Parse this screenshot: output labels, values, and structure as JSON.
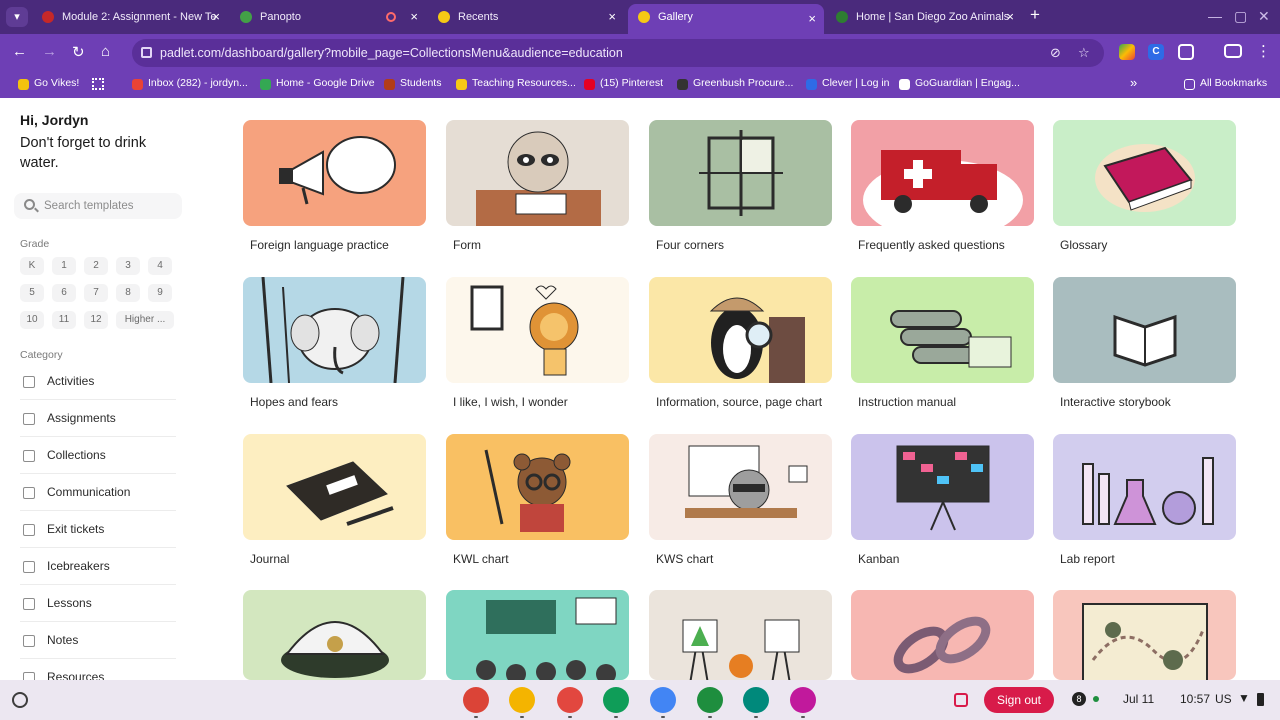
{
  "browser": {
    "tabs": [
      {
        "title": "Module 2: Assignment - New Te",
        "color": "#c62828"
      },
      {
        "title": "Panopto",
        "color": "#43a047"
      },
      {
        "title": "Recents",
        "color": "#f6c915"
      },
      {
        "title": "Gallery",
        "color": "#f6c915"
      },
      {
        "title": "Home | San Diego Zoo Animals",
        "color": "#2e7d32"
      }
    ],
    "url": "padlet.com/dashboard/gallery?mobile_page=CollectionsMenu&audience=education",
    "bookmarks": [
      {
        "label": "Go Vikes!",
        "color": "#f4c20d"
      },
      {
        "label": "Inbox (282) - jordyn...",
        "color": "#ea4335"
      },
      {
        "label": "Home - Google Drive",
        "color": "#34a853"
      },
      {
        "label": "Students",
        "color": "#b23c17"
      },
      {
        "label": "Teaching Resources...",
        "color": "#f6c915"
      },
      {
        "label": "(15) Pinterest",
        "color": "#e60023"
      },
      {
        "label": "Greenbush Procure...",
        "color": "#333333"
      },
      {
        "label": "Clever | Log in",
        "color": "#2e6be6"
      },
      {
        "label": "GoGuardian | Engag...",
        "color": "#ffffff"
      }
    ],
    "all_bookmarks": "All Bookmarks",
    "more_bookmarks": "»"
  },
  "sidebar": {
    "greeting": "Hi, Jordyn",
    "message": "Don't forget to drink water.",
    "search_placeholder": "Search templates",
    "grade_label": "Grade",
    "grades": [
      "K",
      "1",
      "2",
      "3",
      "4",
      "5",
      "6",
      "7",
      "8",
      "9",
      "10",
      "11",
      "12",
      "Higher ..."
    ],
    "category_label": "Category",
    "categories": [
      "Activities",
      "Assignments",
      "Collections",
      "Communication",
      "Exit tickets",
      "Icebreakers",
      "Lessons",
      "Notes",
      "Resources"
    ]
  },
  "gallery": {
    "cards": [
      {
        "title": "Foreign language practice",
        "bg": "#f6a27e",
        "art": "megaphone"
      },
      {
        "title": "Form",
        "bg": "#e5ddd4",
        "art": "sloth"
      },
      {
        "title": "Four corners",
        "bg": "#a9bfa3",
        "art": "corners"
      },
      {
        "title": "Frequently asked questions",
        "bg": "#f2a0a6",
        "art": "ambulance"
      },
      {
        "title": "Glossary",
        "bg": "#c9eec8",
        "art": "book-red"
      },
      {
        "title": "Hopes and fears",
        "bg": "#b5d8e6",
        "art": "elephant"
      },
      {
        "title": "I like, I wish, I wonder",
        "bg": "#fdf7ec",
        "art": "lion"
      },
      {
        "title": "Information, source, page chart",
        "bg": "#fbe7a7",
        "art": "penguin"
      },
      {
        "title": "Instruction manual",
        "bg": "#c8eda9",
        "art": "pipes"
      },
      {
        "title": "Interactive storybook",
        "bg": "#a9bdbf",
        "art": "open-book"
      },
      {
        "title": "Journal",
        "bg": "#fdeec1",
        "art": "journal"
      },
      {
        "title": "KWL chart",
        "bg": "#f9c063",
        "art": "bear"
      },
      {
        "title": "KWS chart",
        "bg": "#f7ebe6",
        "art": "raccoon"
      },
      {
        "title": "Kanban",
        "bg": "#cbc3ec",
        "art": "kanban"
      },
      {
        "title": "Lab report",
        "bg": "#d2cdee",
        "art": "lab"
      },
      {
        "title": "",
        "bg": "#d3e7bf",
        "art": "cap"
      },
      {
        "title": "",
        "bg": "#7fd6c2",
        "art": "classroom"
      },
      {
        "title": "",
        "bg": "#ebe4dc",
        "art": "easels"
      },
      {
        "title": "",
        "bg": "#f7b7b2",
        "art": "chain"
      },
      {
        "title": "",
        "bg": "#f8c6bd",
        "art": "map"
      }
    ]
  },
  "shelf": {
    "apps": [
      {
        "name": "chrome",
        "color": "#db4437"
      },
      {
        "name": "slides",
        "color": "#f4b400"
      },
      {
        "name": "canvas",
        "color": "#e2473f"
      },
      {
        "name": "sheets",
        "color": "#0f9d58"
      },
      {
        "name": "docs",
        "color": "#4285f4"
      },
      {
        "name": "classroom",
        "color": "#1e8e3e"
      },
      {
        "name": "meet",
        "color": "#00897b"
      },
      {
        "name": "padlet",
        "color": "#c1199c"
      }
    ],
    "sign_out": "Sign out",
    "notifications": "8",
    "date": "Jul 11",
    "time": "10:57",
    "locale": "US"
  }
}
